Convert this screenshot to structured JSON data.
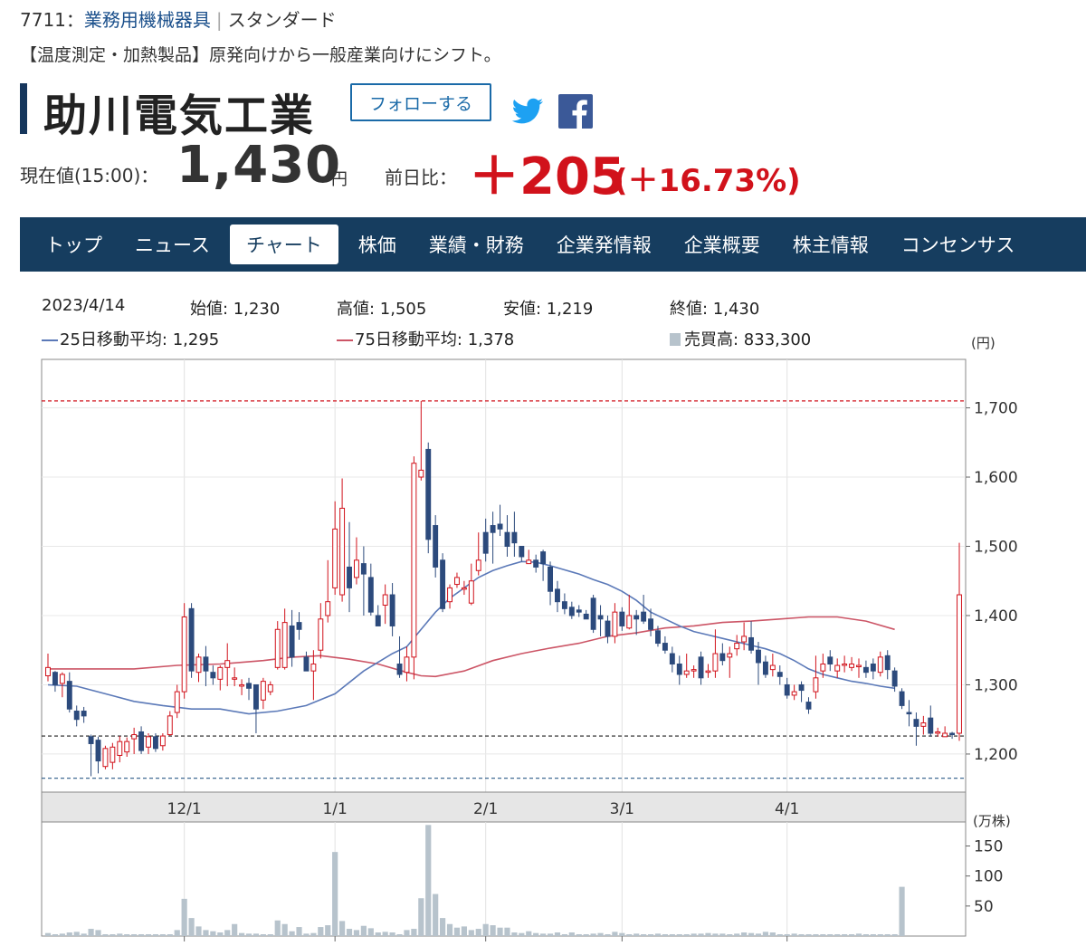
{
  "header": {
    "code": "7711：",
    "industry": "業務用機械器具",
    "market": "スタンダード",
    "description": "【温度測定・加熱製品】原発向けから一般産業向けにシフト。",
    "company_name": "助川電気工業",
    "follow_label": "フォローする"
  },
  "quote": {
    "price_label": "現在値(15:00)：",
    "price": "1,430",
    "unit": "円",
    "change_label": "前日比：",
    "change": "＋205",
    "change_pct": "(＋16.73%)"
  },
  "nav": {
    "items": [
      "トップ",
      "ニュース",
      "チャート",
      "株価",
      "業績・財務",
      "企業発情報",
      "企業概要",
      "株主情報",
      "コンセンサス"
    ],
    "active_index": 2
  },
  "summary": {
    "date": "2023/4/14",
    "open": "始値: 1,230",
    "high": "高値: 1,505",
    "low": "安値: 1,219",
    "close": "終値: 1,430",
    "ma25": "25日移動平均: 1,295",
    "ma75": "75日移動平均: 1,378",
    "volume": "売買高: 833,300"
  },
  "colors": {
    "up": "#d1121b",
    "down": "#2c4a7c",
    "ma25": "#5b79b8",
    "ma75": "#cc5566",
    "volume": "#b7c3cc",
    "nav": "#163d5f"
  },
  "icons": {
    "twitter": "twitter-icon",
    "facebook": "facebook-icon"
  },
  "chart_data": {
    "type": "candlestick",
    "price_unit": "(円)",
    "volume_unit": "(万株)",
    "y_ticks": [
      "1,700",
      "1,600",
      "1,500",
      "1,400",
      "1,300",
      "1,200"
    ],
    "y_tick_values": [
      1700,
      1600,
      1500,
      1400,
      1300,
      1200
    ],
    "ylim": [
      1145,
      1770
    ],
    "volume_ticks": [
      "150",
      "100",
      "50"
    ],
    "volume_tick_values": [
      150,
      100,
      50
    ],
    "volume_ylim": [
      0,
      190
    ],
    "x_labels": [
      "12/1",
      "1/1",
      "2/1",
      "3/1",
      "4/1"
    ],
    "x_label_index": [
      19,
      40,
      61,
      80,
      103
    ],
    "ref_lines": [
      {
        "value": 1710,
        "style": "red-dashed"
      },
      {
        "value": 1226,
        "style": "black-dashed"
      },
      {
        "value": 1165,
        "style": "blue-dashed"
      }
    ],
    "candles": [
      [
        1313,
        1325,
        1345,
        1305
      ],
      [
        1318,
        1300,
        1320,
        1290
      ],
      [
        1302,
        1315,
        1318,
        1282
      ],
      [
        1305,
        1265,
        1318,
        1260
      ],
      [
        1262,
        1250,
        1270,
        1240
      ],
      [
        1262,
        1255,
        1268,
        1245
      ],
      [
        1225,
        1215,
        1228,
        1168
      ],
      [
        1220,
        1190,
        1225,
        1172
      ],
      [
        1182,
        1208,
        1212,
        1178
      ],
      [
        1188,
        1210,
        1216,
        1178
      ],
      [
        1198,
        1218,
        1226,
        1188
      ],
      [
        1203,
        1218,
        1224,
        1196
      ],
      [
        1222,
        1228,
        1238,
        1200
      ],
      [
        1232,
        1205,
        1240,
        1200
      ],
      [
        1210,
        1225,
        1230,
        1200
      ],
      [
        1225,
        1208,
        1230,
        1203
      ],
      [
        1212,
        1226,
        1230,
        1205
      ],
      [
        1228,
        1255,
        1262,
        1226
      ],
      [
        1260,
        1290,
        1300,
        1252
      ],
      [
        1290,
        1398,
        1418,
        1280
      ],
      [
        1410,
        1320,
        1418,
        1310
      ],
      [
        1318,
        1340,
        1345,
        1304
      ],
      [
        1340,
        1320,
        1356,
        1298
      ],
      [
        1318,
        1310,
        1328,
        1300
      ],
      [
        1308,
        1325,
        1328,
        1292
      ],
      [
        1325,
        1335,
        1360,
        1298
      ],
      [
        1310,
        1310,
        1325,
        1298
      ],
      [
        1300,
        1300,
        1308,
        1285
      ],
      [
        1302,
        1295,
        1310,
        1278
      ],
      [
        1300,
        1265,
        1300,
        1230
      ],
      [
        1278,
        1305,
        1310,
        1265
      ],
      [
        1290,
        1300,
        1305,
        1285
      ],
      [
        1325,
        1380,
        1392,
        1322
      ],
      [
        1325,
        1390,
        1410,
        1322
      ],
      [
        1385,
        1340,
        1408,
        1326
      ],
      [
        1390,
        1380,
        1405,
        1365
      ],
      [
        1340,
        1320,
        1348,
        1325
      ],
      [
        1320,
        1330,
        1350,
        1278
      ],
      [
        1350,
        1395,
        1418,
        1338
      ],
      [
        1400,
        1420,
        1480,
        1390
      ],
      [
        1440,
        1525,
        1565,
        1430
      ],
      [
        1430,
        1555,
        1598,
        1420
      ],
      [
        1470,
        1440,
        1535,
        1405
      ],
      [
        1455,
        1480,
        1513,
        1445
      ],
      [
        1475,
        1460,
        1500,
        1400
      ],
      [
        1455,
        1405,
        1475,
        1400
      ],
      [
        1400,
        1385,
        1415,
        1385
      ],
      [
        1415,
        1430,
        1445,
        1388
      ],
      [
        1430,
        1385,
        1447,
        1370
      ],
      [
        1330,
        1315,
        1370,
        1310
      ],
      [
        1318,
        1340,
        1355,
        1305
      ],
      [
        1340,
        1620,
        1630,
        1308
      ],
      [
        1600,
        1610,
        1710,
        1595
      ],
      [
        1640,
        1510,
        1650,
        1490
      ],
      [
        1530,
        1470,
        1545,
        1455
      ],
      [
        1480,
        1410,
        1490,
        1405
      ],
      [
        1420,
        1440,
        1445,
        1410
      ],
      [
        1445,
        1455,
        1462,
        1440
      ],
      [
        1440,
        1440,
        1450,
        1430
      ],
      [
        1418,
        1450,
        1475,
        1415
      ],
      [
        1465,
        1480,
        1520,
        1458
      ],
      [
        1520,
        1490,
        1540,
        1478
      ],
      [
        1530,
        1520,
        1550,
        1475
      ],
      [
        1532,
        1525,
        1560,
        1515
      ],
      [
        1520,
        1500,
        1545,
        1485
      ],
      [
        1520,
        1505,
        1550,
        1485
      ],
      [
        1500,
        1485,
        1500,
        1478
      ],
      [
        1475,
        1480,
        1495,
        1478
      ],
      [
        1480,
        1470,
        1488,
        1462
      ],
      [
        1492,
        1475,
        1495,
        1450
      ],
      [
        1470,
        1435,
        1478,
        1415
      ],
      [
        1438,
        1420,
        1450,
        1405
      ],
      [
        1420,
        1410,
        1432,
        1402
      ],
      [
        1412,
        1400,
        1420,
        1395
      ],
      [
        1408,
        1405,
        1415,
        1398
      ],
      [
        1402,
        1395,
        1408,
        1395
      ],
      [
        1425,
        1380,
        1430,
        1375
      ],
      [
        1400,
        1395,
        1415,
        1370
      ],
      [
        1392,
        1370,
        1400,
        1360
      ],
      [
        1370,
        1405,
        1418,
        1360
      ],
      [
        1405,
        1385,
        1412,
        1378
      ],
      [
        1382,
        1400,
        1430,
        1380
      ],
      [
        1400,
        1395,
        1408,
        1372
      ],
      [
        1405,
        1392,
        1430,
        1388
      ],
      [
        1395,
        1380,
        1410,
        1370
      ],
      [
        1378,
        1360,
        1385,
        1355
      ],
      [
        1360,
        1350,
        1370,
        1345
      ],
      [
        1345,
        1330,
        1355,
        1318
      ],
      [
        1330,
        1315,
        1342,
        1300
      ],
      [
        1315,
        1320,
        1345,
        1310
      ],
      [
        1320,
        1322,
        1328,
        1310
      ],
      [
        1340,
        1310,
        1348,
        1300
      ],
      [
        1320,
        1320,
        1330,
        1310
      ],
      [
        1320,
        1345,
        1380,
        1310
      ],
      [
        1345,
        1335,
        1360,
        1328
      ],
      [
        1340,
        1345,
        1355,
        1310
      ],
      [
        1352,
        1360,
        1372,
        1342
      ],
      [
        1362,
        1370,
        1390,
        1350
      ],
      [
        1368,
        1350,
        1392,
        1345
      ],
      [
        1350,
        1332,
        1362,
        1300
      ],
      [
        1333,
        1315,
        1342,
        1310
      ],
      [
        1322,
        1328,
        1345,
        1312
      ],
      [
        1318,
        1312,
        1328,
        1300
      ],
      [
        1300,
        1285,
        1310,
        1280
      ],
      [
        1285,
        1290,
        1300,
        1278
      ],
      [
        1300,
        1292,
        1305,
        1275
      ],
      [
        1275,
        1265,
        1282,
        1258
      ],
      [
        1290,
        1310,
        1342,
        1280
      ],
      [
        1320,
        1330,
        1345,
        1310
      ],
      [
        1340,
        1330,
        1350,
        1320
      ],
      [
        1320,
        1328,
        1338,
        1310
      ],
      [
        1330,
        1330,
        1342,
        1318
      ],
      [
        1325,
        1330,
        1340,
        1320
      ],
      [
        1328,
        1328,
        1338,
        1310
      ],
      [
        1325,
        1318,
        1335,
        1310
      ],
      [
        1330,
        1320,
        1338,
        1308
      ],
      [
        1318,
        1340,
        1348,
        1312
      ],
      [
        1342,
        1322,
        1350,
        1308
      ],
      [
        1320,
        1298,
        1325,
        1290
      ],
      [
        1290,
        1270,
        1295,
        1265
      ],
      [
        1260,
        1258,
        1278,
        1240
      ],
      [
        1250,
        1240,
        1260,
        1212
      ],
      [
        1240,
        1245,
        1255,
        1228
      ],
      [
        1252,
        1230,
        1270,
        1225
      ],
      [
        1232,
        1232,
        1238,
        1225
      ],
      [
        1225,
        1230,
        1240,
        1225
      ],
      [
        1230,
        1228,
        1232,
        1222
      ],
      [
        1230,
        1430,
        1505,
        1219
      ]
    ],
    "ma25": [
      [
        0,
        1300
      ],
      [
        4,
        1298
      ],
      [
        8,
        1287
      ],
      [
        12,
        1276
      ],
      [
        16,
        1270
      ],
      [
        20,
        1265
      ],
      [
        24,
        1265
      ],
      [
        28,
        1258
      ],
      [
        32,
        1262
      ],
      [
        36,
        1270
      ],
      [
        40,
        1287
      ],
      [
        44,
        1320
      ],
      [
        48,
        1345
      ],
      [
        50,
        1355
      ],
      [
        52,
        1380
      ],
      [
        54,
        1405
      ],
      [
        56,
        1425
      ],
      [
        58,
        1440
      ],
      [
        60,
        1455
      ],
      [
        62,
        1465
      ],
      [
        64,
        1472
      ],
      [
        66,
        1478
      ],
      [
        68,
        1477
      ],
      [
        70,
        1472
      ],
      [
        72,
        1466
      ],
      [
        74,
        1460
      ],
      [
        76,
        1452
      ],
      [
        78,
        1445
      ],
      [
        80,
        1435
      ],
      [
        82,
        1422
      ],
      [
        84,
        1405
      ],
      [
        86,
        1395
      ],
      [
        88,
        1385
      ],
      [
        90,
        1377
      ],
      [
        92,
        1372
      ],
      [
        94,
        1367
      ],
      [
        96,
        1362
      ],
      [
        98,
        1357
      ],
      [
        100,
        1352
      ],
      [
        102,
        1345
      ],
      [
        104,
        1335
      ],
      [
        106,
        1323
      ],
      [
        108,
        1315
      ],
      [
        110,
        1310
      ],
      [
        112,
        1305
      ],
      [
        114,
        1302
      ],
      [
        116,
        1298
      ],
      [
        118,
        1295
      ]
    ],
    "ma75": [
      [
        0,
        1323
      ],
      [
        6,
        1323
      ],
      [
        12,
        1323
      ],
      [
        18,
        1328
      ],
      [
        24,
        1330
      ],
      [
        30,
        1335
      ],
      [
        34,
        1340
      ],
      [
        38,
        1342
      ],
      [
        42,
        1337
      ],
      [
        46,
        1330
      ],
      [
        50,
        1318
      ],
      [
        52,
        1313
      ],
      [
        54,
        1312
      ],
      [
        58,
        1320
      ],
      [
        62,
        1335
      ],
      [
        66,
        1345
      ],
      [
        70,
        1353
      ],
      [
        74,
        1360
      ],
      [
        78,
        1370
      ],
      [
        82,
        1375
      ],
      [
        86,
        1382
      ],
      [
        90,
        1385
      ],
      [
        94,
        1390
      ],
      [
        98,
        1392
      ],
      [
        102,
        1395
      ],
      [
        106,
        1398
      ],
      [
        110,
        1398
      ],
      [
        114,
        1392
      ],
      [
        118,
        1380
      ]
    ],
    "volume": [
      5,
      3,
      4,
      6,
      7,
      4,
      12,
      10,
      3,
      3,
      4,
      3,
      3,
      3,
      3,
      3,
      3,
      3,
      10,
      62,
      30,
      16,
      10,
      8,
      6,
      10,
      20,
      5,
      4,
      4,
      3,
      3,
      26,
      20,
      8,
      15,
      4,
      5,
      15,
      18,
      140,
      25,
      12,
      10,
      17,
      13,
      6,
      7,
      6,
      3,
      10,
      12,
      63,
      185,
      70,
      30,
      20,
      14,
      16,
      10,
      12,
      20,
      18,
      14,
      14,
      6,
      5,
      8,
      5,
      4,
      4,
      6,
      3,
      6,
      3,
      3,
      4,
      5,
      3,
      7,
      5,
      3,
      4,
      3,
      3,
      4,
      3,
      3,
      3,
      3,
      4,
      4,
      5,
      4,
      4,
      3,
      4,
      6,
      5,
      4,
      7,
      6,
      3,
      3,
      4,
      3,
      3,
      3,
      3,
      3,
      3,
      3,
      3,
      4,
      3,
      3,
      3,
      3,
      3,
      82
    ]
  }
}
